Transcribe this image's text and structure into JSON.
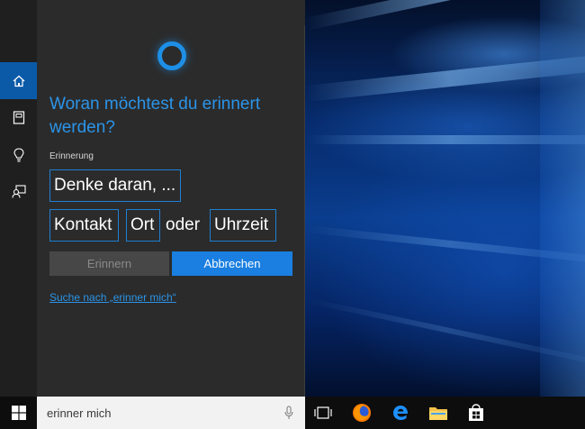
{
  "cortana": {
    "question": "Woran möchtest du erinnert werden?",
    "label": "Erinnerung",
    "reminder_field": "Denke daran, ...",
    "contact_field": "Kontakt",
    "place_field": "Ort",
    "or_text": "oder",
    "time_field": "Uhrzeit",
    "remind_button": "Erinnern",
    "cancel_button": "Abbrechen",
    "search_link": "Suche nach „erinner mich“"
  },
  "taskbar": {
    "search_value": "erinner mich"
  },
  "colors": {
    "accent": "#1a7fe0",
    "panel_bg": "#2b2b2b",
    "rail_bg": "#1f1f1f",
    "active_rail": "#0b5aa8"
  }
}
